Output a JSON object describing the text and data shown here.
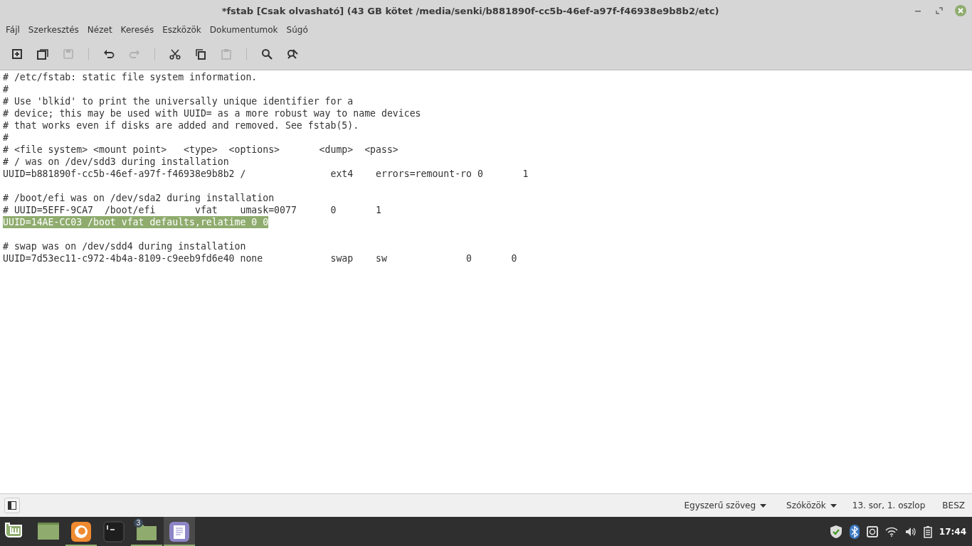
{
  "window": {
    "title": "*fstab [Csak olvasható] (43 GB kötet /media/senki/b881890f-cc5b-46ef-a97f-f46938e9b8b2/etc)"
  },
  "menu": [
    "Fájl",
    "Szerkesztés",
    "Nézet",
    "Keresés",
    "Eszközök",
    "Dokumentumok",
    "Súgó"
  ],
  "toolbar": [
    [
      {
        "disabled": false
      },
      {
        "disabled": false
      },
      {
        "disabled": true
      }
    ],
    [
      {
        "disabled": false
      },
      {
        "disabled": true
      }
    ],
    [
      {
        "disabled": false
      },
      {
        "disabled": false
      },
      {
        "disabled": true
      }
    ],
    [
      {
        "disabled": false
      },
      {
        "disabled": false
      }
    ]
  ],
  "editor": {
    "blocks": [
      {
        "lines": [
          {
            "text": "# /etc/fstab: static file system information.",
            "selected": false
          },
          {
            "text": "#",
            "selected": false
          },
          {
            "text": "# Use 'blkid' to print the universally unique identifier for a",
            "selected": false
          },
          {
            "text": "# device; this may be used with UUID= as a more robust way to name devices",
            "selected": false
          },
          {
            "text": "# that works even if disks are added and removed. See fstab(5).",
            "selected": false
          },
          {
            "text": "#",
            "selected": false
          },
          {
            "text": "# <file system> <mount point>   <type>  <options>       <dump>  <pass>",
            "selected": false
          },
          {
            "text": "# / was on /dev/sdd3 during installation",
            "selected": false
          },
          {
            "text": "UUID=b881890f-cc5b-46ef-a97f-f46938e9b8b2 /               ext4    errors=remount-ro 0       1",
            "selected": false
          }
        ]
      },
      {
        "lines": [
          {
            "text": "# /boot/efi was on /dev/sda2 during installation",
            "selected": false
          },
          {
            "text": "# UUID=5EFF-9CA7  /boot/efi       vfat    umask=0077      0       1",
            "selected": false
          },
          {
            "text": "UUID=14AE-CC03 /boot vfat defaults,relatime 0 0",
            "selected": true
          }
        ]
      },
      {
        "lines": [
          {
            "text": "# swap was on /dev/sdd4 during installation",
            "selected": false
          },
          {
            "text": "UUID=7d53ec11-c972-4b4a-8109-c9eeb9fd6e40 none            swap    sw              0       0",
            "selected": false
          }
        ]
      }
    ]
  },
  "status_bar": {
    "language": "Egyszerű szöveg",
    "indent": "Szóközök",
    "position": "13. sor, 1. oszlop",
    "mode": "BESZ"
  },
  "taskbar": {
    "launchers": [
      {
        "running": false,
        "active": false
      },
      {
        "running": false,
        "active": false
      },
      {
        "running": true,
        "active": false
      },
      {
        "running": false,
        "active": false
      },
      {
        "running": true,
        "active": false,
        "badge": "3"
      },
      {
        "running": true,
        "active": true
      }
    ],
    "clock": "17:44"
  }
}
